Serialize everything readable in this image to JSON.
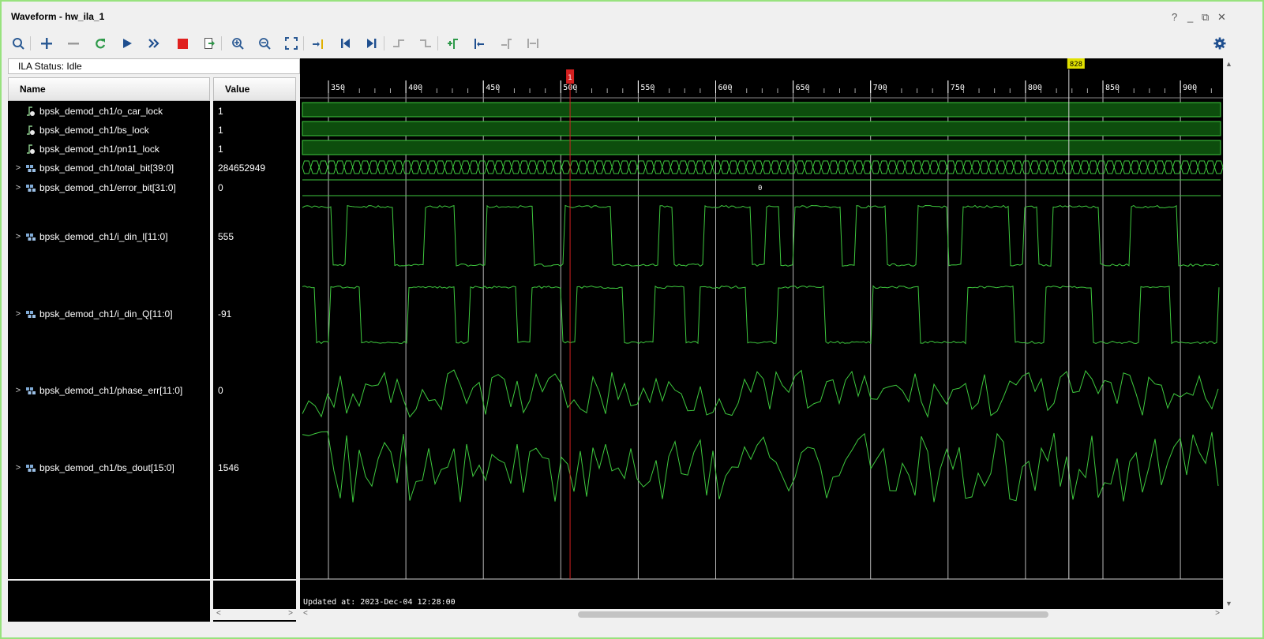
{
  "window": {
    "title": "Waveform - hw_ila_1",
    "controls": [
      "?",
      "_",
      "⧉",
      "✕"
    ]
  },
  "toolbar": [
    {
      "name": "search-icon"
    },
    {
      "name": "plus-icon"
    },
    {
      "name": "minus-icon"
    },
    {
      "name": "refresh-icon"
    },
    {
      "name": "run-trigger-icon"
    },
    {
      "name": "run-immediate-icon"
    },
    {
      "name": "stop-icon"
    },
    {
      "name": "export-icon"
    },
    {
      "name": "zoom-in-icon"
    },
    {
      "name": "zoom-out-icon"
    },
    {
      "name": "zoom-fit-icon"
    },
    {
      "name": "go-to-cursor-icon"
    },
    {
      "name": "go-to-start-icon"
    },
    {
      "name": "go-to-end-icon"
    },
    {
      "name": "previous-transition-icon"
    },
    {
      "name": "next-transition-icon"
    },
    {
      "name": "add-marker-icon"
    },
    {
      "name": "previous-marker-icon"
    },
    {
      "name": "next-marker-icon"
    },
    {
      "name": "swap-cursors-icon"
    },
    {
      "name": "settings-gear-icon"
    }
  ],
  "ila_status": "ILA Status:  Idle",
  "columns": {
    "name": "Name",
    "value": "Value"
  },
  "signals": [
    {
      "name": "bpsk_demod_ch1/o_car_lock",
      "value": "1",
      "type": "bit",
      "expandable": false
    },
    {
      "name": "bpsk_demod_ch1/bs_lock",
      "value": "1",
      "type": "bit",
      "expandable": false
    },
    {
      "name": "bpsk_demod_ch1/pn11_lock",
      "value": "1",
      "type": "bit",
      "expandable": false
    },
    {
      "name": "bpsk_demod_ch1/total_bit[39:0]",
      "value": "284652949",
      "type": "bus",
      "expandable": true
    },
    {
      "name": "bpsk_demod_ch1/error_bit[31:0]",
      "value": "0",
      "type": "bus",
      "expandable": true
    },
    {
      "name": "bpsk_demod_ch1/i_din_I[11:0]",
      "value": "555",
      "type": "analog",
      "expandable": true
    },
    {
      "name": "bpsk_demod_ch1/i_din_Q[11:0]",
      "value": "-91",
      "type": "analog",
      "expandable": true
    },
    {
      "name": "bpsk_demod_ch1/phase_err[11:0]",
      "value": "0",
      "type": "analog",
      "expandable": true
    },
    {
      "name": "bpsk_demod_ch1/bs_dout[15:0]",
      "value": "1546",
      "type": "analog",
      "expandable": true
    }
  ],
  "timeline": {
    "ticks": [
      "350",
      "400",
      "450",
      "500",
      "550",
      "600",
      "650",
      "700",
      "750",
      "800",
      "850",
      "900"
    ],
    "tick_values": [
      350,
      400,
      450,
      500,
      550,
      600,
      650,
      700,
      750,
      800,
      850,
      900
    ],
    "cursor_red": {
      "label": "1",
      "position": 506
    },
    "marker_yellow": {
      "label": "828",
      "position": 828
    },
    "error_bit_bus_label": "0"
  },
  "updated_at": "Updated at: 2023-Dec-04 12:28:00",
  "colors": {
    "wave": "#3ec93e",
    "bit_fill": "#0d4d0d",
    "cursor": "#d42020",
    "marker": "#e0e000",
    "grid": "#d8d8d8"
  }
}
